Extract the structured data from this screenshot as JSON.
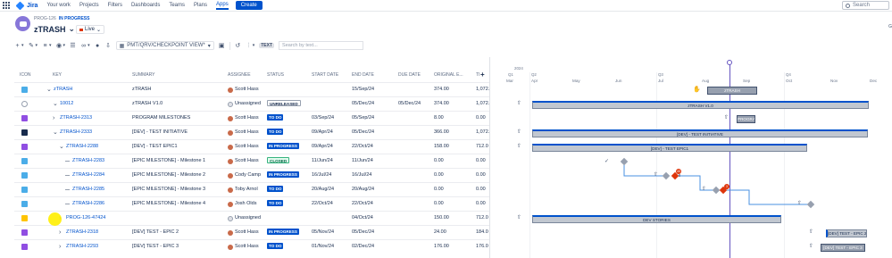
{
  "nav": {
    "brand": "Jira",
    "items": [
      "Your work",
      "Projects",
      "Filters",
      "Dashboards",
      "Teams",
      "Plans",
      "Apps"
    ],
    "active": "Apps",
    "create_label": "Create",
    "search_placeholder": "Search"
  },
  "header": {
    "breadcrumb_key": "PROG-126",
    "breadcrumb_status": "IN PROGRESS",
    "title": "zTRASH",
    "live_label": "Live",
    "right_text": "G"
  },
  "toolbar": {
    "view_name": "PMT/QRV/CHECKPOINT VIEW*",
    "text_tag": "TEXT",
    "search_placeholder": "Search by text..."
  },
  "columns": [
    "ICON",
    "KEY",
    "SUMMARY",
    "ASSIGNEE",
    "STATUS",
    "START DATE",
    "END DATE",
    "DUE DATE",
    "ORIGINAL E...",
    "TI"
  ],
  "rows": [
    {
      "key": "zTRASH",
      "summary": "zTRASH",
      "assignee": "Scott Hass",
      "status": "",
      "start": "",
      "end": "15/Sep/24",
      "due": "",
      "orig": "374.00",
      "ti": "1,072."
    },
    {
      "key": "10012",
      "summary": "zTRASH V1.0",
      "assignee": "Unassigned",
      "status": "UNRELEASED",
      "start": "",
      "end": "05/Dec/24",
      "due": "05/Dec/24",
      "orig": "374.00",
      "ti": "1,072."
    },
    {
      "key": "ZTRASH-2313",
      "summary": "PROGRAM MILESTONES",
      "assignee": "Scott Hass",
      "status": "TO DO",
      "start": "03/Sep/24",
      "end": "05/Sep/24",
      "due": "",
      "orig": "8.00",
      "ti": "0.00"
    },
    {
      "key": "ZTRASH-2333",
      "summary": "[DEV] - TEST INITIATIVE",
      "assignee": "Scott Hass",
      "status": "TO DO",
      "start": "09/Apr/24",
      "end": "05/Dec/24",
      "due": "",
      "orig": "366.00",
      "ti": "1,072."
    },
    {
      "key": "ZTRASH-2288",
      "summary": "[DEV] - TEST EPIC1",
      "assignee": "Scott Hass",
      "status": "IN PROGRESS",
      "start": "09/Apr/24",
      "end": "22/Oct/24",
      "due": "",
      "orig": "158.00",
      "ti": "712.0"
    },
    {
      "key": "ZTRASH-2283",
      "summary": "[EPIC MILESTONE] - Milestone 1",
      "assignee": "Scott Hass",
      "status": "CLOSED",
      "start": "11/Jun/24",
      "end": "11/Jun/24",
      "due": "",
      "orig": "0.00",
      "ti": "0.00"
    },
    {
      "key": "ZTRASH-2284",
      "summary": "[EPIC MILESTONE] - Milestone 2",
      "assignee": "Cody Camp",
      "status": "IN PROGRESS",
      "start": "16/Jul/24",
      "end": "16/Jul/24",
      "due": "",
      "orig": "0.00",
      "ti": "0.00"
    },
    {
      "key": "ZTRASH-2285",
      "summary": "[EPIC MILESTONE] - Milestone 3",
      "assignee": "Toby Arnol",
      "status": "TO DO",
      "start": "20/Aug/24",
      "end": "20/Aug/24",
      "due": "",
      "orig": "0.00",
      "ti": "0.00"
    },
    {
      "key": "ZTRASH-2286",
      "summary": "[EPIC MILESTONE] - Milestone 4",
      "assignee": "Josh Olds",
      "status": "TO DO",
      "start": "22/Oct/24",
      "end": "22/Oct/24",
      "due": "",
      "orig": "0.00",
      "ti": "0.00"
    },
    {
      "key": "PROG-126-47424",
      "summary": "",
      "assignee": "Unassigned",
      "status": "",
      "start": "",
      "end": "04/Oct/24",
      "due": "",
      "orig": "150.00",
      "ti": "712.0"
    },
    {
      "key": "ZTRASH-2318",
      "summary": "[DEV] TEST - EPIC 2",
      "assignee": "Scott Hass",
      "status": "IN PROGRESS",
      "start": "05/Nov/24",
      "end": "05/Dec/24",
      "due": "",
      "orig": "24.00",
      "ti": "184.0"
    },
    {
      "key": "ZTRASH-2293",
      "summary": "[DEV] TEST - EPIC 3",
      "assignee": "Scott Hass",
      "status": "TO DO",
      "start": "01/Nov/24",
      "end": "02/Dec/24",
      "due": "",
      "orig": "176.00",
      "ti": "176.0"
    }
  ],
  "timeline": {
    "year": "2024",
    "quarters": [
      "Q1",
      "Q2",
      "Q3",
      "Q4"
    ],
    "months": [
      "Mar",
      "Apr",
      "May",
      "Jun",
      "Jul",
      "Aug",
      "Sep",
      "Oct",
      "Nov",
      "Dec"
    ],
    "bar_labels": {
      "r0": "zTRASH",
      "r1": "zTRASH V1.0",
      "r2": "PROGRAM",
      "r3": "[DEV] - TEST INITIATIVE",
      "r4": "[DEV] - TEST EPIC1",
      "r9": "DEV STORIES",
      "r10": "[DEV] TEST - EPIC 2",
      "r11": "[DEV] TEST - EPIC 3"
    },
    "badges": [
      "45",
      "3"
    ]
  },
  "colors": {
    "brand_blue": "#0052cc",
    "epic_purple": "#904ee2",
    "today_line": "#6554c0",
    "milestone_red": "#de350b"
  }
}
